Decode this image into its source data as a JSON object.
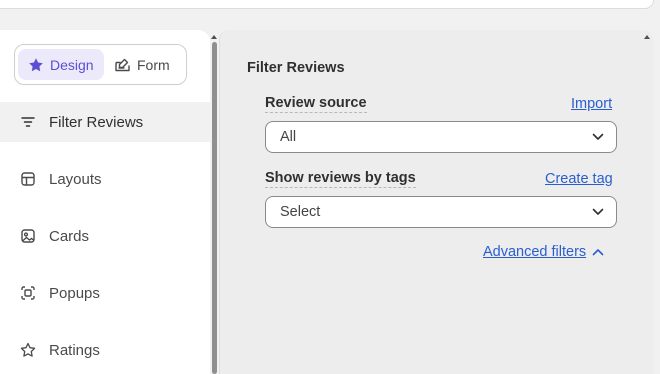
{
  "toggle": {
    "design_label": "Design",
    "form_label": "Form"
  },
  "sidebar": {
    "items": [
      {
        "label": "Filter Reviews",
        "icon": "filter-lines-icon",
        "active": true
      },
      {
        "label": "Layouts",
        "icon": "layout-icon",
        "active": false
      },
      {
        "label": "Cards",
        "icon": "card-image-icon",
        "active": false
      },
      {
        "label": "Popups",
        "icon": "popup-icon",
        "active": false
      },
      {
        "label": "Ratings",
        "icon": "star-outline-icon",
        "active": false
      }
    ]
  },
  "panel": {
    "title": "Filter Reviews",
    "review_source": {
      "label": "Review source",
      "link": "Import",
      "value": "All"
    },
    "tags": {
      "label": "Show reviews by tags",
      "link": "Create tag",
      "value": "Select"
    },
    "advanced_filters": "Advanced filters"
  },
  "colors": {
    "accent": "#5b4fd6",
    "accent_bg": "#ece9fb",
    "link": "#2a5ecf",
    "panel_bg": "#ededed"
  }
}
